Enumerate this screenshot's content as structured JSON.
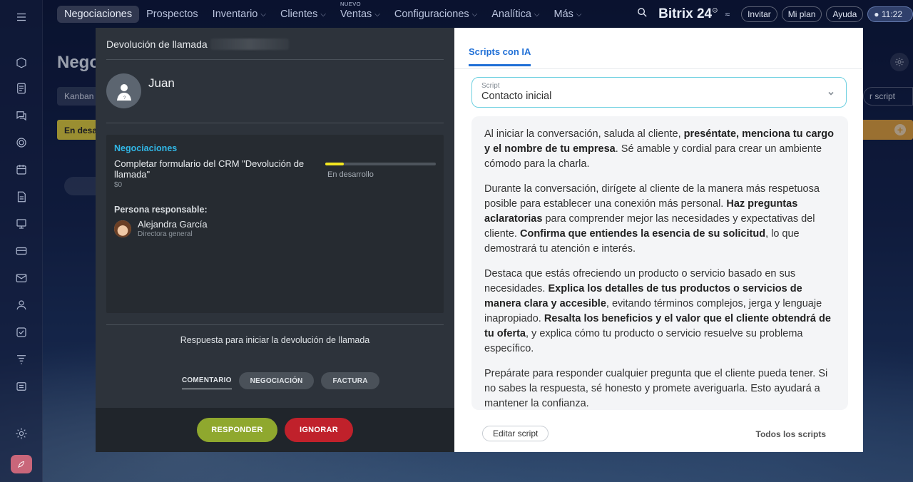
{
  "topnav": {
    "items": [
      {
        "label": "Negociaciones",
        "active": true,
        "chevron": false
      },
      {
        "label": "Prospectos",
        "active": false,
        "chevron": false
      },
      {
        "label": "Inventario",
        "active": false,
        "chevron": true
      },
      {
        "label": "Clientes",
        "active": false,
        "chevron": true
      },
      {
        "label": "Ventas",
        "active": false,
        "chevron": true,
        "badge": "NUEVO"
      },
      {
        "label": "Configuraciones",
        "active": false,
        "chevron": true
      },
      {
        "label": "Analítica",
        "active": false,
        "chevron": true
      },
      {
        "label": "Más",
        "active": false,
        "chevron": true
      }
    ],
    "brand": "Bitrix 24",
    "invite_label": "Invitar",
    "plan_label": "Mi plan",
    "help_label": "Ayuda",
    "time": "11:22"
  },
  "background": {
    "page_title": "Nego",
    "kanban_label": "Kanban",
    "stage_label": "En desa",
    "script_label": "r script"
  },
  "call": {
    "header": "Devolución de llamada",
    "caller_name": "Juan",
    "deal": {
      "section": "Negociaciones",
      "name": "Completar formulario del CRM \"Devolución de llamada\"",
      "amount": "$0",
      "stage": "En desarrollo",
      "progress": 0.17
    },
    "responsible": {
      "label": "Persona responsable:",
      "name": "Alejandra García",
      "title": "Directora general"
    },
    "reply_label": "Respuesta para iniciar la devolución de llamada",
    "tabs": [
      "COMENTARIO",
      "NEGOCIACIÓN",
      "FACTURA"
    ],
    "answer_label": "RESPONDER",
    "ignore_label": "IGNORAR"
  },
  "ai": {
    "tab_label": "Scripts con IA",
    "select_label": "Script",
    "select_value": "Contacto inicial",
    "paragraphs": [
      [
        {
          "t": "Al iniciar la conversación, saluda al cliente, "
        },
        {
          "t": "preséntate, menciona tu cargo y el nombre de tu empresa",
          "b": true
        },
        {
          "t": ". Sé amable y cordial para crear un ambiente cómodo para la charla."
        }
      ],
      [
        {
          "t": "Durante la conversación, dirígete al cliente de la manera más respetuosa posible para establecer una conexión más personal. "
        },
        {
          "t": "Haz preguntas aclaratorias",
          "b": true
        },
        {
          "t": " para comprender mejor las necesidades y expectativas del cliente. "
        },
        {
          "t": "Confirma que entiendes la esencia de su solicitud",
          "b": true
        },
        {
          "t": ", lo que demostrará tu atención e interés."
        }
      ],
      [
        {
          "t": "Destaca que estás ofreciendo un producto o servicio basado en sus necesidades. "
        },
        {
          "t": "Explica los detalles de tus productos o servicios de manera clara y accesible",
          "b": true
        },
        {
          "t": ", evitando términos complejos, jerga y lenguaje inapropiado. "
        },
        {
          "t": "Resalta los beneficios y el valor que el cliente obtendrá de tu oferta",
          "b": true
        },
        {
          "t": ", y explica cómo tu producto o servicio resuelve su problema específico."
        }
      ],
      [
        {
          "t": "Prepárate para responder cualquier pregunta que el cliente pueda tener. Si no sabes la respuesta, sé honesto y promete averiguarla. Esto ayudará a mantener la confianza."
        }
      ]
    ],
    "edit_label": "Editar script",
    "all_label": "Todos los scripts"
  },
  "sidebar": {
    "icons": [
      "menu-icon",
      "crm-icon",
      "feed-icon",
      "chat-icon",
      "target-icon",
      "calendar-icon",
      "document-icon",
      "presentation-icon",
      "card-icon",
      "mail-icon",
      "contacts-icon",
      "tasks-icon",
      "filter-icon",
      "list-icon",
      "settings-icon"
    ]
  }
}
